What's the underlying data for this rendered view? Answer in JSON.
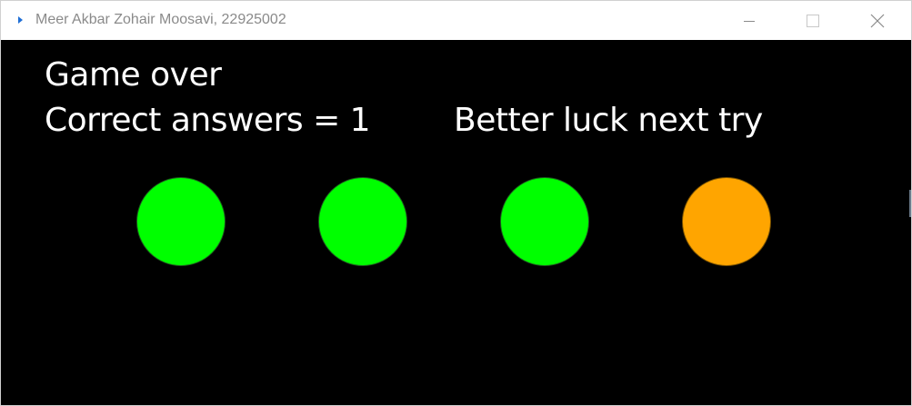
{
  "window": {
    "title": "Meer Akbar Zohair Moosavi, 22925002",
    "app_icon": "app-icon",
    "controls": [
      "minimize-icon",
      "maximize-icon",
      "close-icon"
    ]
  },
  "game": {
    "status": "Game over",
    "score_text": "Correct answers = 1",
    "message": "Better luck next try",
    "background_color": "#000000",
    "text_color": "#ffffff",
    "indicators": [
      {
        "color": "#00ff00"
      },
      {
        "color": "#00ff00"
      },
      {
        "color": "#00ff00"
      },
      {
        "color": "#ffa500"
      }
    ]
  }
}
